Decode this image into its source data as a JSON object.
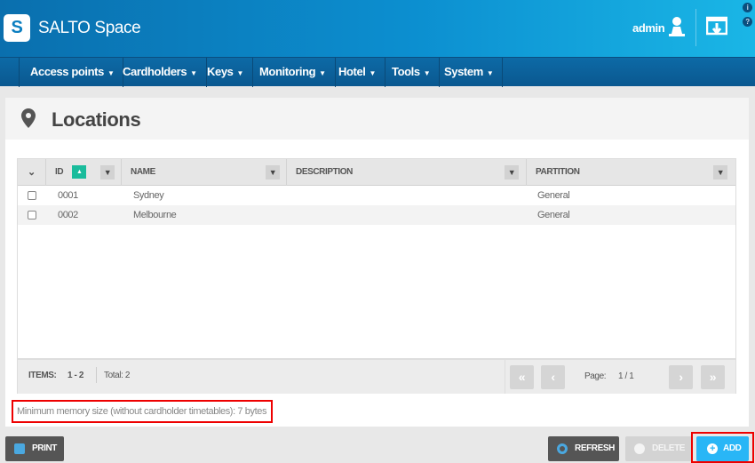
{
  "header": {
    "logo_letter": "S",
    "brand": "SALTO Space",
    "user": "admin",
    "info_icons": [
      "i",
      "?"
    ]
  },
  "nav": [
    {
      "label": "Access points"
    },
    {
      "label": "Cardholders"
    },
    {
      "label": "Keys"
    },
    {
      "label": "Monitoring"
    },
    {
      "label": "Hotel"
    },
    {
      "label": "Tools"
    },
    {
      "label": "System"
    }
  ],
  "page": {
    "title": "Locations"
  },
  "grid": {
    "columns": [
      "ID",
      "NAME",
      "DESCRIPTION",
      "PARTITION"
    ],
    "rows": [
      {
        "id": "0001",
        "name": "Sydney",
        "description": "",
        "partition": "General"
      },
      {
        "id": "0002",
        "name": "Melbourne",
        "description": "",
        "partition": "General"
      }
    ],
    "footer": {
      "items_label": "ITEMS:",
      "items_range": "1 - 2",
      "total": "Total: 2",
      "page_label": "Page:",
      "page_value": "1 / 1"
    }
  },
  "memory_note": "Minimum memory size (without cardholder timetables): 7 bytes",
  "buttons": {
    "print": "PRINT",
    "refresh": "REFRESH",
    "delete": "DELETE",
    "add": "ADD"
  },
  "colors": {
    "header": "#0c8fd0",
    "nav": "#0a5f98",
    "sort": "#1abc9c",
    "add": "#29b6f6",
    "highlight": "#e00000"
  }
}
